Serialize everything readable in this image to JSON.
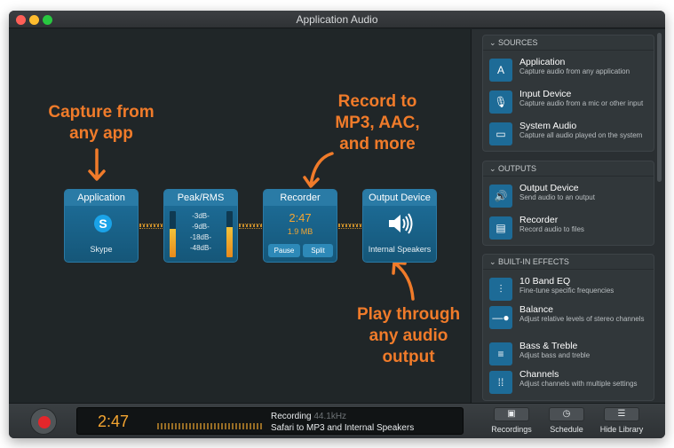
{
  "window": {
    "title": "Application Audio"
  },
  "annotations": {
    "capture": [
      "Capture from",
      "any app"
    ],
    "record": [
      "Record to",
      "MP3, AAC,",
      "and more"
    ],
    "play": [
      "Play through",
      "any audio",
      "output"
    ]
  },
  "nodes": {
    "application": {
      "title": "Application",
      "sub": "Skype"
    },
    "peak": {
      "title": "Peak/RMS",
      "labels": [
        "-3dB-",
        "-9dB-",
        "-18dB-",
        "-48dB-"
      ],
      "left_level": 0.62,
      "right_level": 0.66
    },
    "recorder": {
      "title": "Recorder",
      "time": "2:47",
      "size": "1.9 MB",
      "pause_label": "Pause",
      "split_label": "Split"
    },
    "output": {
      "title": "Output Device",
      "sub": "Internal Speakers"
    }
  },
  "sidebar": {
    "sources": {
      "header": "SOURCES",
      "items": [
        {
          "title": "Application",
          "desc": "Capture audio from any application",
          "icon": "app-icon"
        },
        {
          "title": "Input Device",
          "desc": "Capture audio from a mic or other input",
          "icon": "microphone-icon"
        },
        {
          "title": "System Audio",
          "desc": "Capture all audio played on the system",
          "icon": "monitor-icon"
        }
      ]
    },
    "outputs": {
      "header": "OUTPUTS",
      "items": [
        {
          "title": "Output Device",
          "desc": "Send audio to an output",
          "icon": "speaker-icon"
        },
        {
          "title": "Recorder",
          "desc": "Record audio to files",
          "icon": "file-icon"
        }
      ]
    },
    "effects": {
      "header": "BUILT-IN EFFECTS",
      "items": [
        {
          "title": "10 Band EQ",
          "desc": "Fine-tune specific frequencies",
          "icon": "eq-icon"
        },
        {
          "title": "Balance",
          "desc": "Adjust relative levels of stereo channels",
          "icon": "balance-icon"
        },
        {
          "title": "Bass & Treble",
          "desc": "Adjust bass and treble",
          "icon": "bass-treble-icon"
        },
        {
          "title": "Channels",
          "desc": "Adjust channels with multiple settings",
          "icon": "channels-icon"
        }
      ]
    }
  },
  "bottom": {
    "time": "2:47",
    "status": "Recording",
    "rate": "44.1kHz",
    "detail": "Safari to MP3 and Internal Speakers",
    "recordings_label": "Recordings",
    "schedule_label": "Schedule",
    "hide_library_label": "Hide Library"
  },
  "colors": {
    "accent": "#f07b2a",
    "node": "#1f5f82",
    "record": "#e4262b"
  }
}
